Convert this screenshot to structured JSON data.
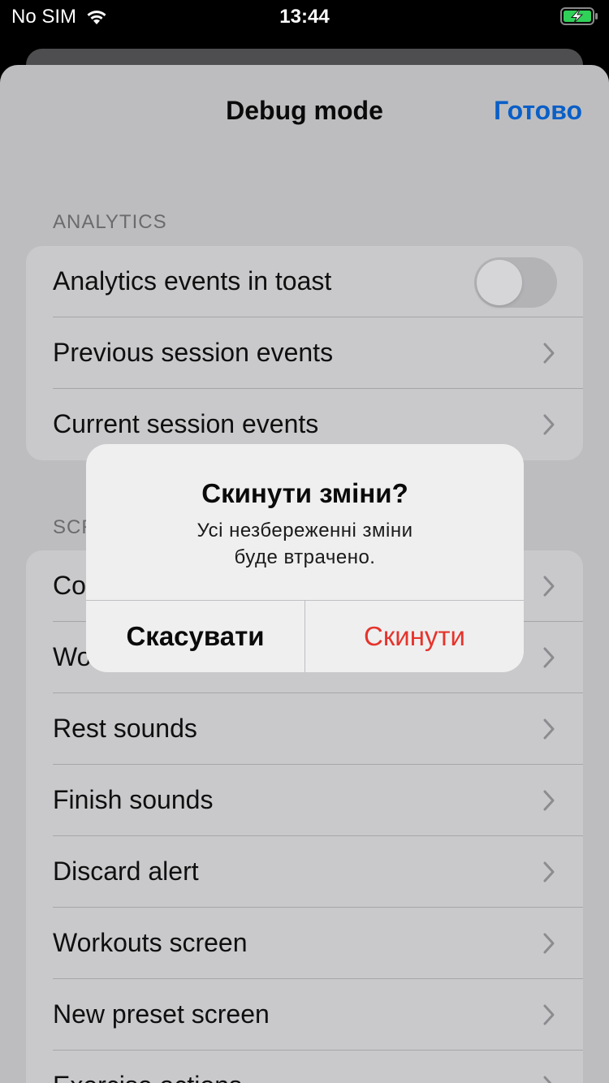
{
  "status_bar": {
    "carrier": "No SIM",
    "time": "13:44",
    "battery_color": "#30d158"
  },
  "nav": {
    "title": "Debug mode",
    "done_label": "Готово",
    "accent_color": "#0a5fc7"
  },
  "analytics": {
    "header": "ANALYTICS",
    "toggle_row_label": "Analytics events in toast",
    "toggle_on": false,
    "items": [
      {
        "label": "Previous session events",
        "icon": "chevron-right-icon"
      },
      {
        "label": "Current session events",
        "icon": "chevron-right-icon"
      }
    ]
  },
  "screens": {
    "header": "SCR",
    "items": [
      {
        "label": "Co",
        "icon": "chevron-right-icon"
      },
      {
        "label": "Wo",
        "icon": "chevron-right-icon"
      },
      {
        "label": "Rest sounds",
        "icon": "chevron-right-icon"
      },
      {
        "label": "Finish sounds",
        "icon": "chevron-right-icon"
      },
      {
        "label": "Discard alert",
        "icon": "chevron-right-icon"
      },
      {
        "label": "Workouts screen",
        "icon": "chevron-right-icon"
      },
      {
        "label": "New preset screen",
        "icon": "chevron-right-icon"
      },
      {
        "label": "Exercise actions",
        "icon": "chevron-right-icon"
      }
    ]
  },
  "alert": {
    "title": "Скинути зміни?",
    "message_line1": "Усі незбереженні зміни",
    "message_line2": "буде втрачено.",
    "cancel_label": "Скасувати",
    "destructive_label": "Скинути",
    "destructive_color": "#e5342c"
  }
}
